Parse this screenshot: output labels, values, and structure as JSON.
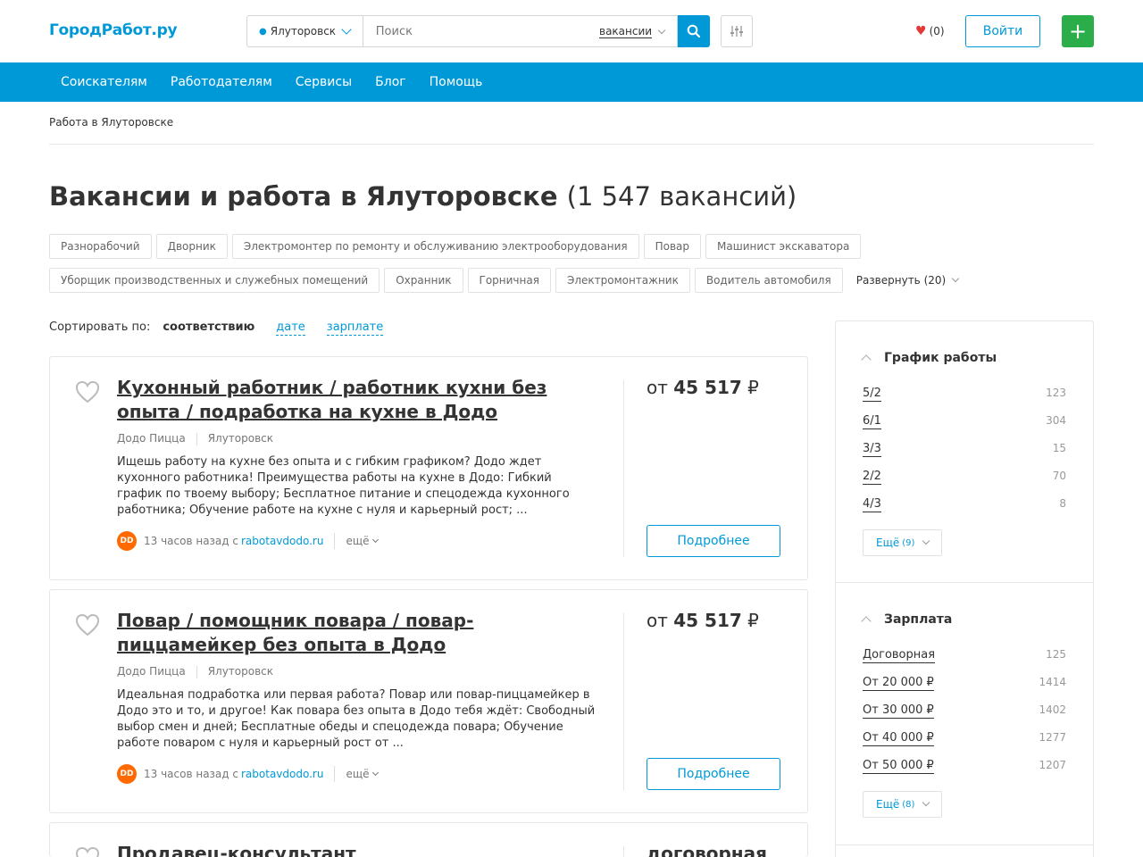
{
  "header": {
    "logo": "ГородРабот.ру",
    "city": "Ялуторовск",
    "search_placeholder": "Поиск",
    "search_type": "вакансии",
    "favorites_count": "(0)",
    "login_label": "Войти",
    "add_label": "+"
  },
  "nav": {
    "items": [
      "Соискателям",
      "Работодателям",
      "Сервисы",
      "Блог",
      "Помощь"
    ]
  },
  "breadcrumb": "Работа в Ялуторовске",
  "page": {
    "title": "Вакансии и работа в Ялуторовске",
    "count": "(1 547 вакансий)"
  },
  "tags": {
    "row1": [
      "Разнорабочий",
      "Дворник",
      "Электромонтер по ремонту и обслуживанию электрооборудования",
      "Повар",
      "Машинист экскаватора"
    ],
    "row2": [
      "Уборщик производственных и служебных помещений",
      "Охранник",
      "Горничная",
      "Электромонтажник",
      "Водитель автомобиля"
    ],
    "expand": "Развернуть (20)"
  },
  "sort": {
    "label": "Сортировать по:",
    "active": "соответствию",
    "options": [
      "дате",
      "зарплате"
    ]
  },
  "vacancies": [
    {
      "title": "Кухонный работник / работник кухни без опыта / подработка на кухне в Додо",
      "company": "Додо Пицца",
      "city": "Ялуторовск",
      "description": "Ищешь работу на кухне без опыта и с гибким графиком? Додо ждет кухонного работника! Преимущества работы на кухне в Додо: Гибкий график по твоему выбору; Бесплатное питание и спецодежда кухонного работника; Обучение работе на кухне с нуля и карьерный рост; ...",
      "time": "13 часов назад с",
      "source": "rabotavdodo.ru",
      "more": "ещё",
      "salary_prefix": "от",
      "salary_value": "45 517",
      "salary_currency": "₽",
      "details_label": "Подробнее"
    },
    {
      "title": "Повар / помощник повара / повар-пиццамейкер без опыта в Додо",
      "company": "Додо Пицца",
      "city": "Ялуторовск",
      "description": "Идеальная подработка или первая работа? Повар или повар-пиццамейкер в Додо это и то, и другое! Как повара без опыта в Додо тебя ждёт: Свободный выбор смен и дней; Бесплатные обеды и спецодежда повара; Обучение работе поваром с нуля и карьерный рост от ...",
      "time": "13 часов назад с",
      "source": "rabotavdodo.ru",
      "more": "ещё",
      "salary_prefix": "от",
      "salary_value": "45 517",
      "salary_currency": "₽",
      "details_label": "Подробнее"
    },
    {
      "title": "Продавец-консультант",
      "salary_text": "договорная"
    }
  ],
  "sidebar": {
    "schedule": {
      "title": "График работы",
      "items": [
        {
          "label": "5/2",
          "count": "123"
        },
        {
          "label": "6/1",
          "count": "304"
        },
        {
          "label": "3/3",
          "count": "15"
        },
        {
          "label": "2/2",
          "count": "70"
        },
        {
          "label": "4/3",
          "count": "8"
        }
      ],
      "more_label": "Ещё",
      "more_count": "(9)"
    },
    "salary": {
      "title": "Зарплата",
      "items": [
        {
          "label": "Договорная",
          "count": "125"
        },
        {
          "label": "От 20 000 ₽",
          "count": "1414"
        },
        {
          "label": "От 30 000 ₽",
          "count": "1402"
        },
        {
          "label": "От 40 000 ₽",
          "count": "1277"
        },
        {
          "label": "От 50 000 ₽",
          "count": "1207"
        }
      ],
      "more_label": "Ещё",
      "more_count": "(8)"
    }
  }
}
